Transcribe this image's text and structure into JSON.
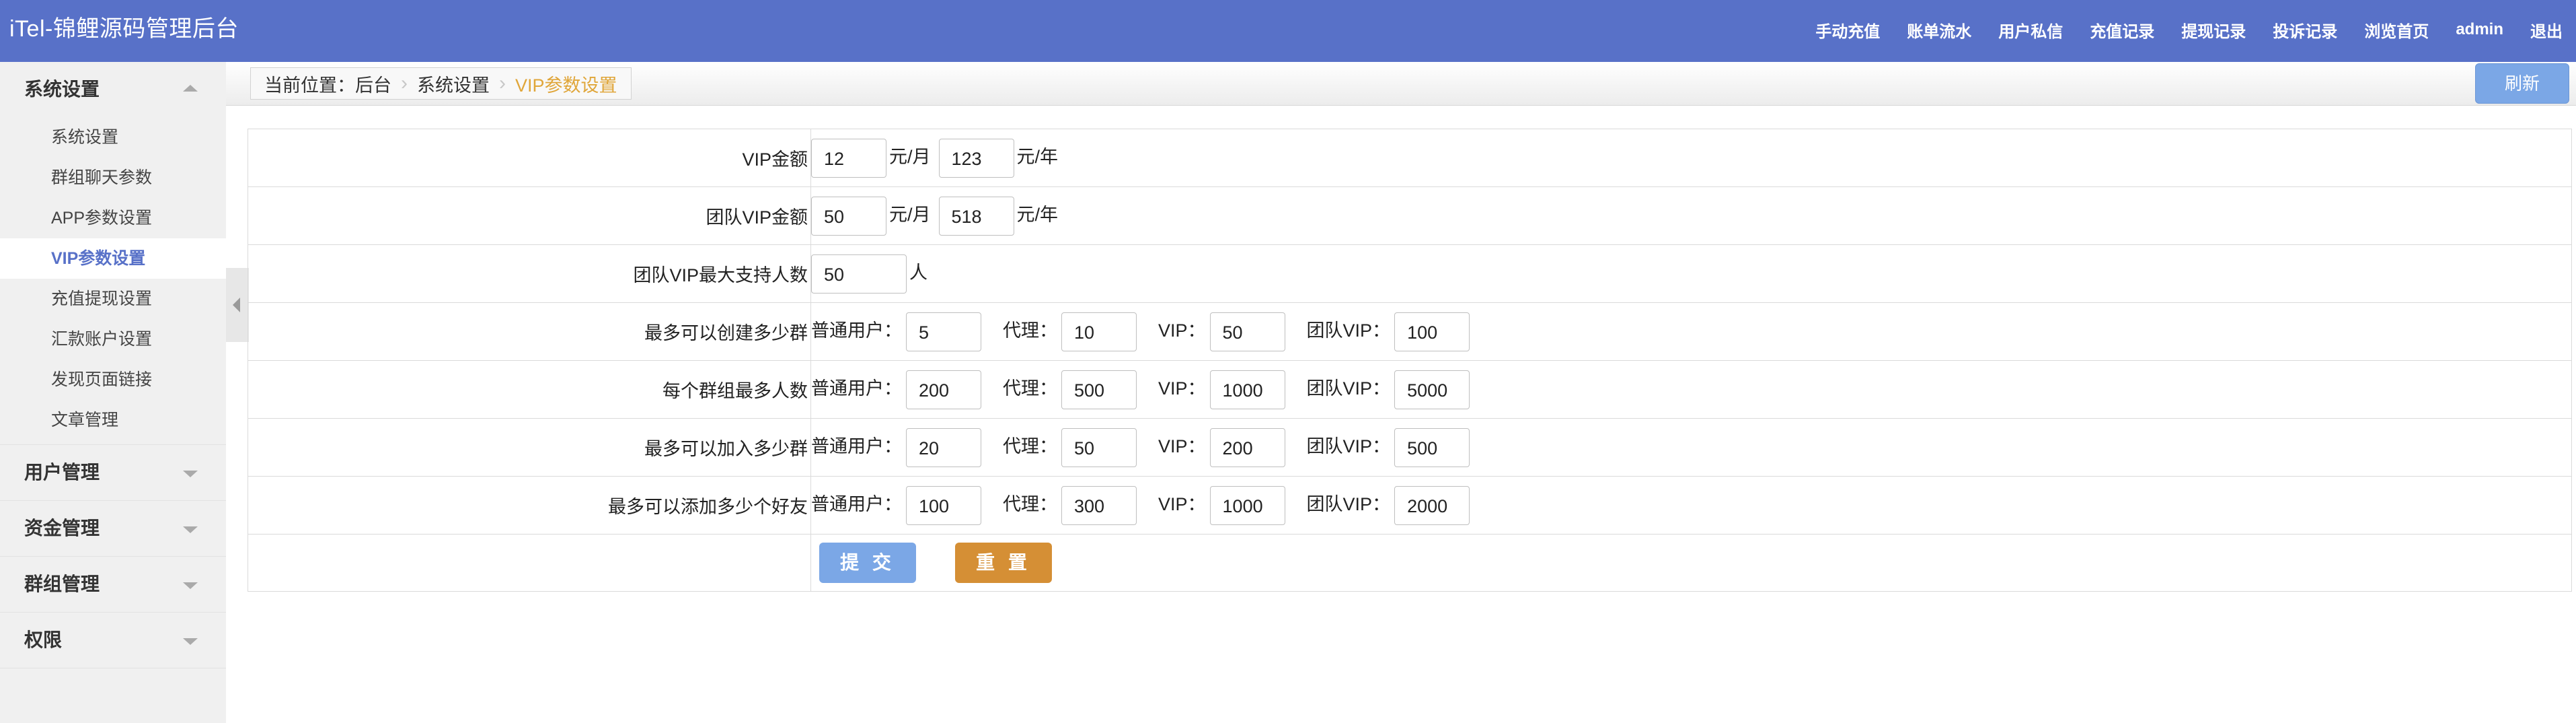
{
  "header": {
    "brand": "iTel-锦鲤源码管理后台",
    "nav": [
      "手动充值",
      "账单流水",
      "用户私信",
      "充值记录",
      "提现记录",
      "投诉记录",
      "浏览首页",
      "admin",
      "退出"
    ]
  },
  "sidebar": {
    "groups": [
      {
        "label": "系统设置",
        "expanded": true,
        "items": [
          "系统设置",
          "群组聊天参数",
          "APP参数设置",
          "VIP参数设置",
          "充值提现设置",
          "汇款账户设置",
          "发现页面链接",
          "文章管理"
        ],
        "active_index": 3
      },
      {
        "label": "用户管理",
        "expanded": false
      },
      {
        "label": "资金管理",
        "expanded": false
      },
      {
        "label": "群组管理",
        "expanded": false
      },
      {
        "label": "权限",
        "expanded": false
      }
    ]
  },
  "breadcrumb": {
    "prefix": "当前位置：后台",
    "middle": "系统设置",
    "current": "VIP参数设置"
  },
  "refresh_label": "刷新",
  "form": {
    "vip_amount": {
      "label": "VIP金额",
      "monthly": "12",
      "monthly_unit": "元/月",
      "yearly": "123",
      "yearly_unit": "元/年"
    },
    "team_vip_amount": {
      "label": "团队VIP金额",
      "monthly": "50",
      "monthly_unit": "元/月",
      "yearly": "518",
      "yearly_unit": "元/年"
    },
    "team_vip_max": {
      "label": "团队VIP最大支持人数",
      "value": "50",
      "unit": "人"
    },
    "tier_labels": {
      "normal": "普通用户：",
      "agent": "代理：",
      "vip": "VIP：",
      "team_vip": "团队VIP："
    },
    "rows": [
      {
        "label": "最多可以创建多少群",
        "normal": "5",
        "agent": "10",
        "vip": "50",
        "team_vip": "100"
      },
      {
        "label": "每个群组最多人数",
        "normal": "200",
        "agent": "500",
        "vip": "1000",
        "team_vip": "5000"
      },
      {
        "label": "最多可以加入多少群",
        "normal": "20",
        "agent": "50",
        "vip": "200",
        "team_vip": "500"
      },
      {
        "label": "最多可以添加多少个好友",
        "normal": "100",
        "agent": "300",
        "vip": "1000",
        "team_vip": "2000"
      }
    ],
    "submit_label": "提 交",
    "reset_label": "重 置"
  },
  "colors": {
    "header_bg": "#5871c8",
    "active_text": "#5871c8",
    "crumb_current": "#e0a63a",
    "submit": "#7ba7e6",
    "reset": "#d58f35"
  }
}
